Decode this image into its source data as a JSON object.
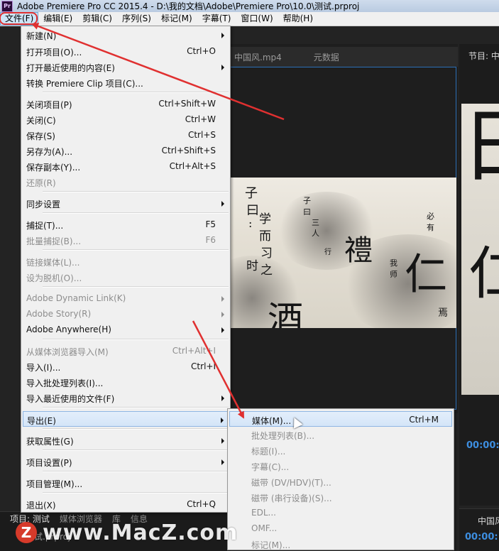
{
  "window": {
    "title": "Adobe Premiere Pro CC 2015.4 - D:\\我的文档\\Adobe\\Premiere Pro\\10.0\\测试.prproj",
    "logo_text": "Pr"
  },
  "menubar": [
    {
      "label": "文件(F)"
    },
    {
      "label": "编辑(E)"
    },
    {
      "label": "剪辑(C)"
    },
    {
      "label": "序列(S)"
    },
    {
      "label": "标记(M)"
    },
    {
      "label": "字幕(T)"
    },
    {
      "label": "窗口(W)"
    },
    {
      "label": "帮助(H)"
    }
  ],
  "source_panel": {
    "tabs": [
      "中国风.mp4",
      "元数据"
    ]
  },
  "program_panel": {
    "tab": "节目: 中",
    "timecode": "00:00:",
    "timecode_bottom": "00:00:",
    "bottom_tab": "中国风"
  },
  "video_frame": {
    "glyphs": [
      "子",
      "曰",
      ":",
      "学",
      "而",
      "时",
      "习",
      "之",
      "禮",
      "仁",
      "酒",
      "子",
      "曰",
      "三",
      "人",
      "行",
      "必",
      "有",
      "我",
      "师",
      "焉"
    ]
  },
  "file_menu": [
    {
      "label": "新建(N)",
      "shortcut": "",
      "submenu": true,
      "disabled": false
    },
    {
      "label": "打开项目(O)...",
      "shortcut": "Ctrl+O",
      "submenu": false,
      "disabled": false
    },
    {
      "label": "打开最近使用的内容(E)",
      "shortcut": "",
      "submenu": true,
      "disabled": false
    },
    {
      "label": "转换 Premiere Clip 项目(C)...",
      "shortcut": "",
      "submenu": false,
      "disabled": false
    },
    {
      "label": "关闭项目(P)",
      "shortcut": "Ctrl+Shift+W",
      "submenu": false,
      "disabled": false
    },
    {
      "label": "关闭(C)",
      "shortcut": "Ctrl+W",
      "submenu": false,
      "disabled": false
    },
    {
      "label": "保存(S)",
      "shortcut": "Ctrl+S",
      "submenu": false,
      "disabled": false
    },
    {
      "label": "另存为(A)...",
      "shortcut": "Ctrl+Shift+S",
      "submenu": false,
      "disabled": false
    },
    {
      "label": "保存副本(Y)...",
      "shortcut": "Ctrl+Alt+S",
      "submenu": false,
      "disabled": false
    },
    {
      "label": "还原(R)",
      "shortcut": "",
      "submenu": false,
      "disabled": true
    },
    {
      "label": "同步设置",
      "shortcut": "",
      "submenu": true,
      "disabled": false
    },
    {
      "label": "捕捉(T)...",
      "shortcut": "F5",
      "submenu": false,
      "disabled": false
    },
    {
      "label": "批量捕捉(B)...",
      "shortcut": "F6",
      "submenu": false,
      "disabled": true
    },
    {
      "label": "链接媒体(L)...",
      "shortcut": "",
      "submenu": false,
      "disabled": true
    },
    {
      "label": "设为脱机(O)...",
      "shortcut": "",
      "submenu": false,
      "disabled": true
    },
    {
      "label": "Adobe Dynamic Link(K)",
      "shortcut": "",
      "submenu": true,
      "disabled": true
    },
    {
      "label": "Adobe Story(R)",
      "shortcut": "",
      "submenu": true,
      "disabled": true
    },
    {
      "label": "Adobe Anywhere(H)",
      "shortcut": "",
      "submenu": true,
      "disabled": false
    },
    {
      "label": "从媒体浏览器导入(M)",
      "shortcut": "Ctrl+Alt+I",
      "submenu": false,
      "disabled": true
    },
    {
      "label": "导入(I)...",
      "shortcut": "Ctrl+I",
      "submenu": false,
      "disabled": false
    },
    {
      "label": "导入批处理列表(I)...",
      "shortcut": "",
      "submenu": false,
      "disabled": false
    },
    {
      "label": "导入最近使用的文件(F)",
      "shortcut": "",
      "submenu": true,
      "disabled": false
    },
    {
      "label": "导出(E)",
      "shortcut": "",
      "submenu": true,
      "disabled": false
    },
    {
      "label": "获取属性(G)",
      "shortcut": "",
      "submenu": true,
      "disabled": false
    },
    {
      "label": "项目设置(P)",
      "shortcut": "",
      "submenu": true,
      "disabled": false
    },
    {
      "label": "项目管理(M)...",
      "shortcut": "",
      "submenu": false,
      "disabled": false
    },
    {
      "label": "退出(X)",
      "shortcut": "Ctrl+Q",
      "submenu": false,
      "disabled": false
    }
  ],
  "export_submenu": [
    {
      "label": "媒体(M)...",
      "shortcut": "Ctrl+M",
      "disabled": false
    },
    {
      "label": "批处理列表(B)...",
      "shortcut": "",
      "disabled": true
    },
    {
      "label": "标题(I)...",
      "shortcut": "",
      "disabled": true
    },
    {
      "label": "字幕(C)...",
      "shortcut": "",
      "disabled": true
    },
    {
      "label": "磁带 (DV/HDV)(T)...",
      "shortcut": "",
      "disabled": true
    },
    {
      "label": "磁带 (串行设备)(S)...",
      "shortcut": "",
      "disabled": true
    },
    {
      "label": "EDL...",
      "shortcut": "",
      "disabled": true
    },
    {
      "label": "OMF...",
      "shortcut": "",
      "disabled": true
    },
    {
      "label": "标记(M)...",
      "shortcut": "",
      "disabled": true
    }
  ],
  "bottom_tabs": [
    "项目: 测试",
    "媒体浏览器",
    "库",
    "信息"
  ],
  "bottom_item": "测试.prproj",
  "watermark": {
    "logo": "Z",
    "text": "www.MacZ.com"
  },
  "colors": {
    "annotation_red": "#e03030",
    "highlight_blue": "#cde4f7",
    "timecode_blue": "#3d8ee0"
  }
}
